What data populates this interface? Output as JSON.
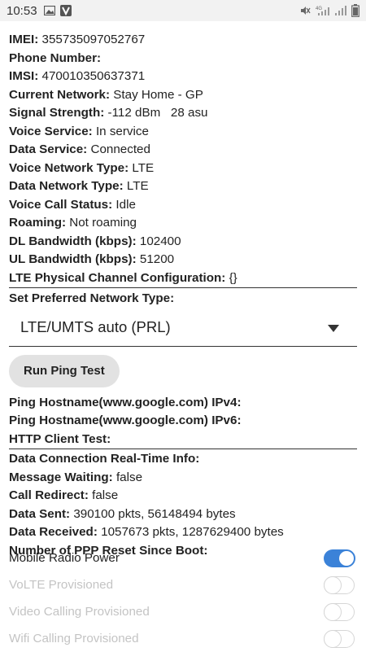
{
  "status_bar": {
    "time": "10:53",
    "net_label_1": "4G",
    "net_label_2": ""
  },
  "info": {
    "imei": {
      "label": "IMEI:",
      "value": "355735097052767"
    },
    "phone_number": {
      "label": "Phone Number:",
      "value": ""
    },
    "imsi": {
      "label": "IMSI:",
      "value": "470010350637371"
    },
    "current_network": {
      "label": "Current Network:",
      "value": "Stay Home - GP"
    },
    "signal_strength": {
      "label": "Signal Strength:",
      "value": "-112 dBm   28 asu"
    },
    "voice_service": {
      "label": "Voice Service:",
      "value": "In service"
    },
    "data_service": {
      "label": "Data Service:",
      "value": "Connected"
    },
    "voice_network_type": {
      "label": "Voice Network Type:",
      "value": "LTE"
    },
    "data_network_type": {
      "label": "Data Network Type:",
      "value": "LTE"
    },
    "voice_call_status": {
      "label": "Voice Call Status:",
      "value": "Idle"
    },
    "roaming": {
      "label": "Roaming:",
      "value": "Not roaming"
    },
    "dl_bandwidth": {
      "label": "DL Bandwidth (kbps):",
      "value": "102400"
    },
    "ul_bandwidth": {
      "label": "UL Bandwidth (kbps):",
      "value": "51200"
    },
    "lte_physical_channel": {
      "label": "LTE Physical Channel Configuration:",
      "value": "{}"
    }
  },
  "preferred_network": {
    "label": "Set Preferred Network Type:",
    "selected": "LTE/UMTS auto (PRL)"
  },
  "ping_button": "Run Ping Test",
  "ping": {
    "ipv4": {
      "label": "Ping Hostname(www.google.com) IPv4:",
      "value": ""
    },
    "ipv6": {
      "label": "Ping Hostname(www.google.com) IPv6:",
      "value": ""
    },
    "http": {
      "label": "HTTP Client Test:",
      "value": ""
    }
  },
  "data_conn": {
    "realtime": {
      "label": "Data Connection Real-Time Info:",
      "value": ""
    },
    "message_waiting": {
      "label": "Message Waiting:",
      "value": "false"
    },
    "call_redirect": {
      "label": "Call Redirect:",
      "value": "false"
    },
    "data_sent": {
      "label": "Data Sent:",
      "value": "390100 pkts, 56148494 bytes"
    },
    "data_received": {
      "label": "Data Received:",
      "value": "1057673 pkts, 1287629400 bytes"
    },
    "ppp_reset": {
      "label": "Number of PPP Reset Since Boot:",
      "value": ""
    }
  },
  "toggles": [
    {
      "label": "Mobile Radio Power",
      "on": true,
      "enabled": true
    },
    {
      "label": "VoLTE Provisioned",
      "on": false,
      "enabled": false
    },
    {
      "label": "Video Calling Provisioned",
      "on": false,
      "enabled": false
    },
    {
      "label": "Wifi Calling Provisioned",
      "on": false,
      "enabled": false
    }
  ]
}
